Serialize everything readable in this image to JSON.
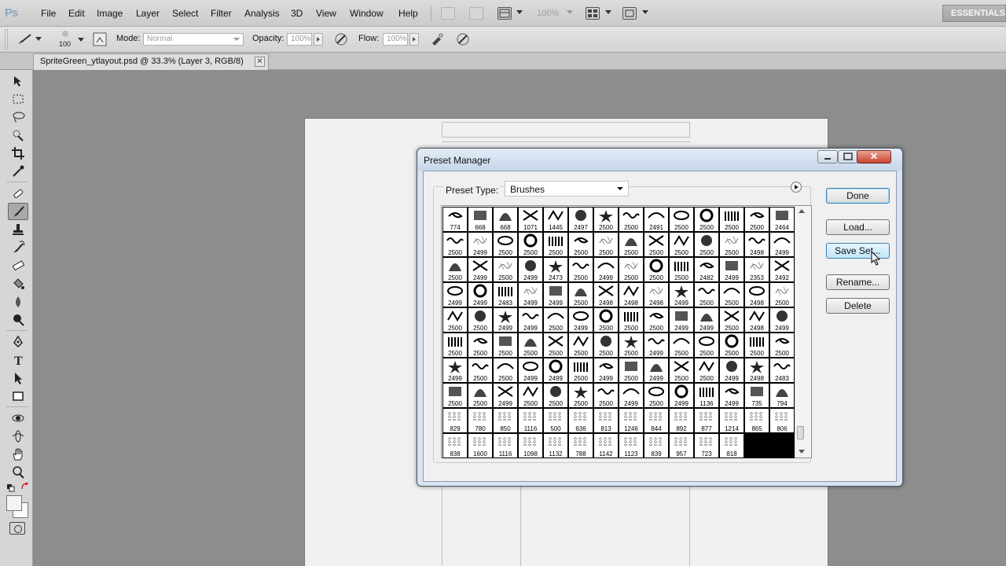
{
  "app": {
    "logo": "Ps",
    "workspace": "ESSENTIALS"
  },
  "menu": [
    "File",
    "Edit",
    "Image",
    "Layer",
    "Select",
    "Filter",
    "Analysis",
    "3D",
    "View",
    "Window",
    "Help"
  ],
  "menubar": {
    "zoom": "100%"
  },
  "options": {
    "brush_size": "100",
    "mode_label": "Mode:",
    "mode_value": "Normal",
    "opacity_label": "Opacity:",
    "opacity_value": "100%",
    "flow_label": "Flow:",
    "flow_value": "100%"
  },
  "document": {
    "tab_title": "SpriteGreen_ytlayout.psd @ 33.3% (Layer 3, RGB/8)",
    "close_glyph": "✕"
  },
  "dialog": {
    "title": "Preset Manager",
    "close_glyph": "✕",
    "preset_type_label": "Preset Type:",
    "preset_type_value": "Brushes",
    "buttons": {
      "done": "Done",
      "load": "Load...",
      "save_set": "Save Set...",
      "rename": "Rename...",
      "delete": "Delete"
    }
  },
  "brushes": [
    "774",
    "668",
    "668",
    "1071",
    "1445",
    "2497",
    "2500",
    "2500",
    "2491",
    "2500",
    "2500",
    "2500",
    "2500",
    "2464",
    "2500",
    "2499",
    "2500",
    "2500",
    "2500",
    "2500",
    "2500",
    "2500",
    "2500",
    "2500",
    "2500",
    "2500",
    "2498",
    "2499",
    "2500",
    "2499",
    "2500",
    "2499",
    "2473",
    "2500",
    "2499",
    "2500",
    "2500",
    "2500",
    "2482",
    "2499",
    "2353",
    "2492",
    "2499",
    "2499",
    "2483",
    "2499",
    "2499",
    "2500",
    "2498",
    "2498",
    "2498",
    "2499",
    "2500",
    "2500",
    "2498",
    "2500",
    "2500",
    "2500",
    "2499",
    "2499",
    "2500",
    "2499",
    "2500",
    "2500",
    "2500",
    "2499",
    "2499",
    "2500",
    "2498",
    "2499",
    "2500",
    "2500",
    "2500",
    "2500",
    "2500",
    "2500",
    "2500",
    "2500",
    "2499",
    "2500",
    "2500",
    "2500",
    "2500",
    "2500",
    "2499",
    "2500",
    "2500",
    "2499",
    "2499",
    "2500",
    "2499",
    "2500",
    "2499",
    "2500",
    "2500",
    "2499",
    "2498",
    "2483",
    "2500",
    "2500",
    "2499",
    "2500",
    "2500",
    "2500",
    "2500",
    "2499",
    "2500",
    "2499",
    "1136",
    "2499",
    "735",
    "794",
    "829",
    "780",
    "850",
    "1116",
    "500",
    "636",
    "813",
    "1246",
    "844",
    "892",
    "877",
    "1214",
    "865",
    "806",
    "838",
    "1600",
    "1116",
    "1098",
    "1132",
    "788",
    "1142",
    "1123",
    "839",
    "957",
    "723",
    "818"
  ]
}
